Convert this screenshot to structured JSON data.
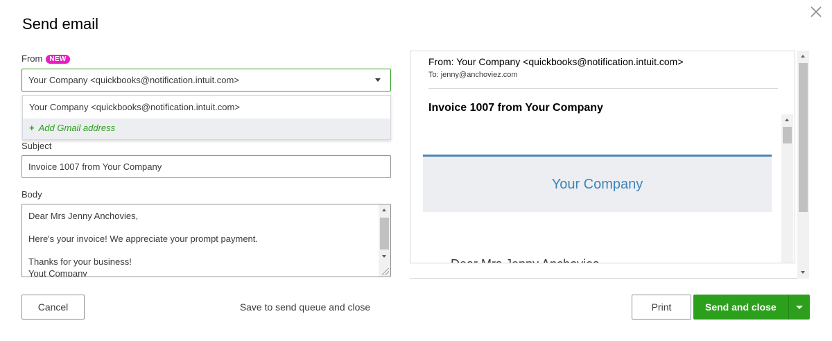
{
  "dialog": {
    "title": "Send email"
  },
  "form": {
    "from_label": "From",
    "from_badge": "NEW",
    "from_value": "Your Company <quickbooks@notification.intuit.com>",
    "from_options": [
      "Your Company <quickbooks@notification.intuit.com>",
      "Add Gmail address"
    ],
    "subject_label": "Subject",
    "subject_value": "Invoice 1007 from Your Company",
    "body_label": "Body",
    "body_value": "Dear Mrs Jenny Anchovies,\n\nHere's your invoice! We appreciate your prompt payment.\n\nThanks for your business!\nYout Company"
  },
  "preview": {
    "from": "From: Your Company <quickbooks@notification.intuit.com>",
    "to": "To: jenny@anchoviez.com",
    "subject": "Invoice 1007 from Your Company",
    "company": "Your Company",
    "greeting": "Dear Mrs Jenny Anchovies,"
  },
  "footer": {
    "cancel": "Cancel",
    "save_queue": "Save to send queue and close",
    "print": "Print",
    "send_close": "Send and close"
  },
  "colors": {
    "accent_green": "#2ca01c",
    "badge_pink": "#e91ec3",
    "company_blue": "#3b84bc"
  },
  "icons": {
    "close": "close-icon",
    "caret": "chevron-down-icon",
    "plus": "plus-icon"
  }
}
